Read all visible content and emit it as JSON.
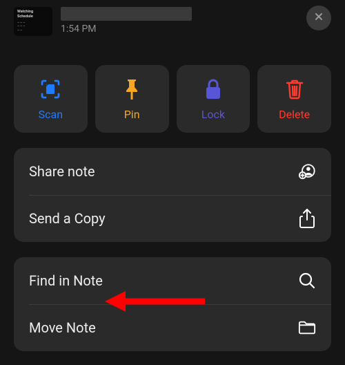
{
  "header": {
    "thumbnail_title": "Watching Schedule",
    "timestamp": "1:54 PM"
  },
  "actions": {
    "scan": "Scan",
    "pin": "Pin",
    "lock": "Lock",
    "delete": "Delete"
  },
  "group1": {
    "share_note": "Share note",
    "send_copy": "Send a Copy"
  },
  "group2": {
    "find_in_note": "Find in Note",
    "move_note": "Move Note"
  },
  "colors": {
    "scan": "#1e7cff",
    "pin": "#f5a623",
    "lock": "#5856d6",
    "delete": "#ff3b30"
  }
}
